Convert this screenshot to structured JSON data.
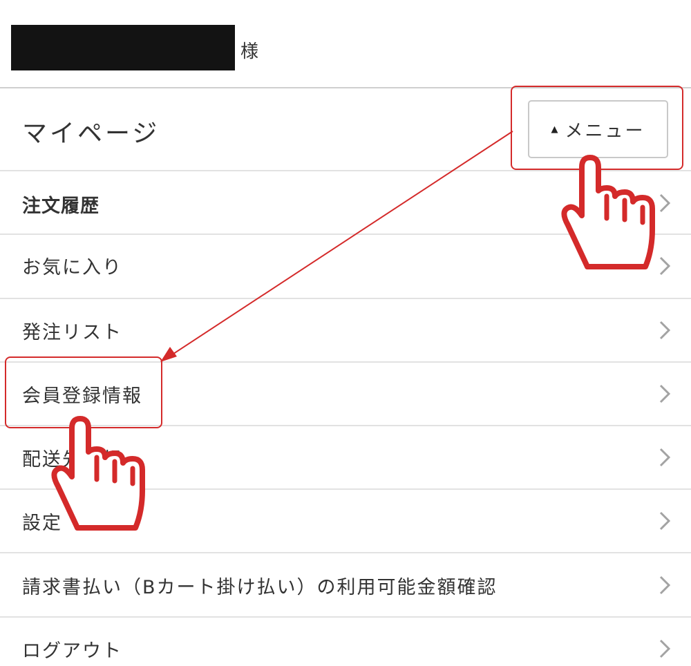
{
  "user": {
    "name_redacted": true,
    "honorific": "様"
  },
  "header": {
    "title": "マイページ",
    "menu_button": {
      "label": "メニュー",
      "icon": "triangle-up-icon"
    }
  },
  "menu": {
    "items": [
      {
        "label": "注文履歴",
        "bold": true
      },
      {
        "label": "お気に入り"
      },
      {
        "label": "発注リスト"
      },
      {
        "label": "会員登録情報",
        "highlighted": true
      },
      {
        "label": "配送先情報"
      },
      {
        "label": "設定"
      },
      {
        "label": "請求書払い（Bカート掛け払い）の利用可能金額確認"
      },
      {
        "label": "ログアウト"
      }
    ]
  },
  "annotations": {
    "color": "#d32f2f",
    "icons": [
      "pointing-hand-icon",
      "arrow-icon"
    ]
  }
}
